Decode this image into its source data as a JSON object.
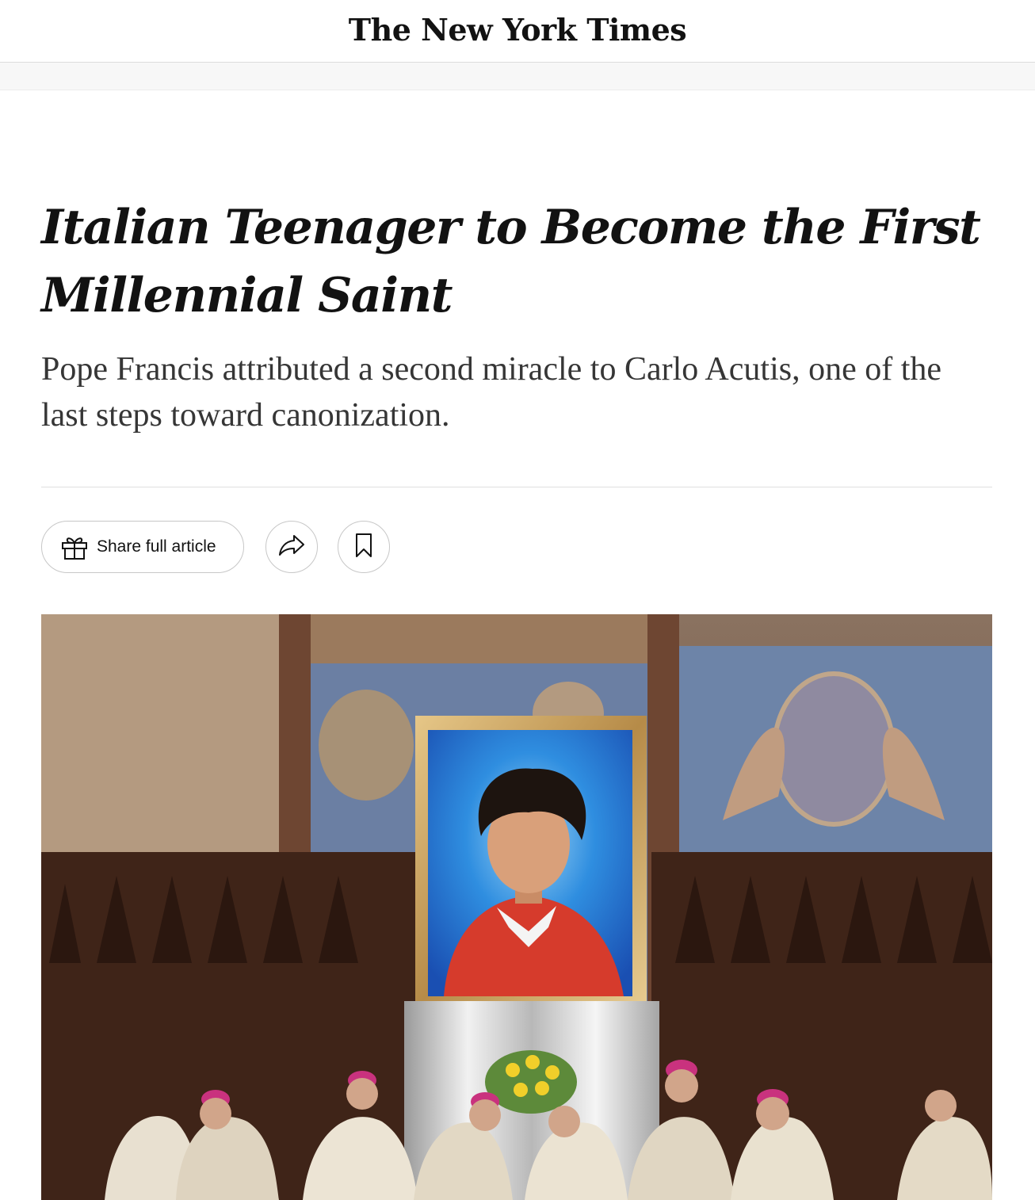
{
  "masthead": {
    "logo_text": "The New York Times"
  },
  "article": {
    "headline": "Italian Teenager to Become the First Millennial Saint",
    "summary": "Pope Francis attributed a second miracle to Carlo Acutis, one of the last steps toward canonization."
  },
  "toolbar": {
    "share_label": "Share full article",
    "gift_icon": "gift-icon",
    "forward_icon": "share-arrow-icon",
    "bookmark_icon": "bookmark-icon"
  },
  "photo": {
    "subject": "Portrait of Carlo Acutis displayed in a basilica with clergy in the foreground"
  },
  "colors": {
    "text": "#121212",
    "summary_text": "#363636",
    "divider": "#dfdfdf",
    "button_border": "#c7c7c7"
  }
}
